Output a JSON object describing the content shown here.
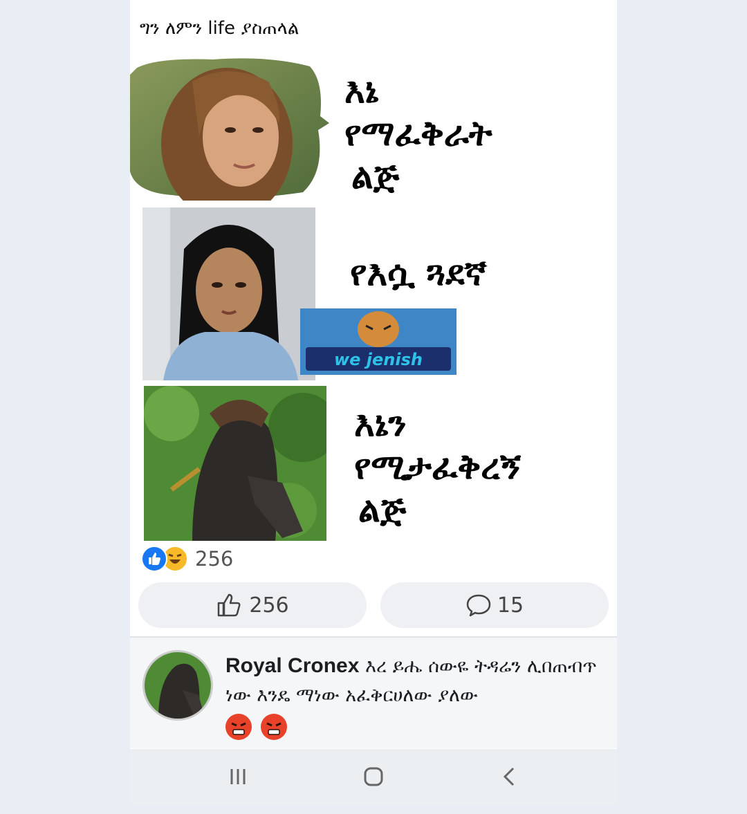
{
  "post": {
    "caption": "ግን ለምን life ያስጠላል",
    "panel1_text": [
      "እኔ",
      "የማፈቅራት",
      "ልጅ"
    ],
    "panel2_text": "የእሷ ጓደኛ",
    "panel3_text": [
      "እኔን",
      "የሚታፈቅረኝ",
      "ልጅ"
    ],
    "watermark_text": "we jenish"
  },
  "reactions": {
    "count": "256"
  },
  "actions": {
    "like_count": "256",
    "comment_count": "15"
  },
  "comment": {
    "author": "Royal Cronex",
    "text": "እረ ይሔ ሰውዬ ትዳሬን ሊበጠብጥ ነው እንዴ ማነው አፈቅርሀለው ያለው"
  },
  "colors": {
    "like_blue": "#1877f2",
    "haha_yellow": "#f7b928",
    "angry_red": "#e8432a"
  },
  "icons": [
    "like-reaction-icon",
    "haha-reaction-icon",
    "thumbs-up-icon",
    "comment-bubble-icon",
    "angry-emoji-icon",
    "recent-apps-icon",
    "home-icon",
    "back-icon"
  ]
}
